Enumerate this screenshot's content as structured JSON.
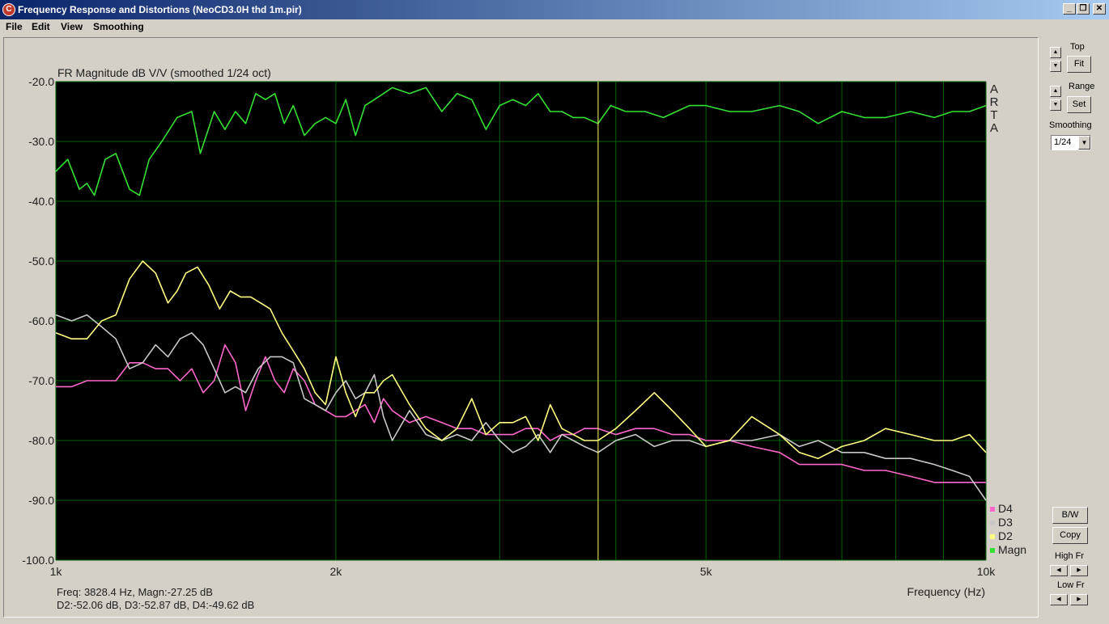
{
  "window": {
    "title": "Frequency Response and Distortions (NeoCD3.0H thd 1m.pir)",
    "min_label": "_",
    "restore_label": "❐",
    "close_label": "✕"
  },
  "menu": {
    "file": "File",
    "edit": "Edit",
    "view": "View",
    "smoothing": "Smoothing"
  },
  "readout": {
    "line1": "Freq: 3828.4 Hz, Magn:-27.25 dB",
    "line2": "D2:-52.06 dB, D3:-52.87 dB, D4:-49.62 dB"
  },
  "arta_letters": [
    "A",
    "R",
    "T",
    "A"
  ],
  "right_panel": {
    "top_label": "Top",
    "fit_label": "Fit",
    "range_label": "Range",
    "set_label": "Set",
    "smoothing_label": "Smoothing",
    "smoothing_value": "1/24",
    "bw_label": "B/W",
    "copy_label": "Copy",
    "high_fr_label": "High Fr",
    "low_fr_label": "Low Fr"
  },
  "colors": {
    "plot_bg": "#000000",
    "grid": "#006400",
    "magn": "#33e033",
    "d2": "#ffff80",
    "d3": "#c8c8c8",
    "d4": "#ff66cc",
    "cursor": "#ffff66"
  },
  "chart_data": {
    "type": "line",
    "title": "FR Magnitude dB V/V (smoothed 1/24 oct)",
    "xlabel": "Frequency (Hz)",
    "ylabel": "",
    "x_scale": "log",
    "xlim": [
      1000,
      10000
    ],
    "ylim": [
      -100,
      -20
    ],
    "y_ticks": [
      -20,
      -30,
      -40,
      -50,
      -60,
      -70,
      -80,
      -90,
      -100
    ],
    "y_tick_labels": [
      "-20.0",
      "-30.0",
      "-40.0",
      "-50.0",
      "-60.0",
      "-70.0",
      "-80.0",
      "-90.0",
      "-100.0"
    ],
    "x_ticks": [
      1000,
      2000,
      5000,
      10000
    ],
    "x_tick_labels": [
      "1k",
      "2k",
      "5k",
      "10k"
    ],
    "x_grid": [
      1000,
      2000,
      3000,
      4000,
      5000,
      6000,
      7000,
      8000,
      9000,
      10000
    ],
    "grid": true,
    "legend_position": "bottom-right",
    "cursor_x": 3828.4,
    "series": [
      {
        "name": "Magn",
        "color_key": "magn",
        "x": [
          1000,
          1030,
          1060,
          1080,
          1100,
          1130,
          1160,
          1200,
          1230,
          1260,
          1300,
          1350,
          1400,
          1430,
          1480,
          1520,
          1560,
          1600,
          1640,
          1680,
          1720,
          1760,
          1800,
          1850,
          1900,
          1950,
          2000,
          2050,
          2100,
          2150,
          2200,
          2250,
          2300,
          2400,
          2500,
          2600,
          2700,
          2800,
          2900,
          3000,
          3100,
          3200,
          3300,
          3400,
          3500,
          3600,
          3700,
          3828,
          3950,
          4100,
          4300,
          4500,
          4800,
          5000,
          5300,
          5600,
          6000,
          6300,
          6600,
          7000,
          7400,
          7800,
          8300,
          8800,
          9200,
          9600,
          10000
        ],
        "values": [
          -35,
          -33,
          -38,
          -37,
          -39,
          -33,
          -32,
          -38,
          -39,
          -33,
          -30,
          -26,
          -25,
          -32,
          -25,
          -28,
          -25,
          -27,
          -22,
          -23,
          -22,
          -27,
          -24,
          -29,
          -27,
          -26,
          -27,
          -23,
          -29,
          -24,
          -23,
          -22,
          -21,
          -22,
          -21,
          -25,
          -22,
          -23,
          -28,
          -24,
          -23,
          -24,
          -22,
          -25,
          -25,
          -26,
          -26,
          -27,
          -24,
          -25,
          -25,
          -26,
          -24,
          -24,
          -25,
          -25,
          -24,
          -25,
          -27,
          -25,
          -26,
          -26,
          -25,
          -26,
          -25,
          -25,
          -24
        ]
      },
      {
        "name": "D2",
        "color_key": "d2",
        "x": [
          1000,
          1040,
          1080,
          1120,
          1160,
          1200,
          1240,
          1280,
          1320,
          1350,
          1380,
          1420,
          1460,
          1500,
          1540,
          1580,
          1620,
          1660,
          1700,
          1750,
          1800,
          1850,
          1900,
          1950,
          2000,
          2050,
          2100,
          2150,
          2200,
          2250,
          2300,
          2400,
          2500,
          2600,
          2700,
          2800,
          2900,
          3000,
          3100,
          3200,
          3300,
          3400,
          3500,
          3600,
          3700,
          3828,
          4000,
          4200,
          4400,
          4600,
          4800,
          5000,
          5300,
          5600,
          6000,
          6300,
          6600,
          7000,
          7400,
          7800,
          8300,
          8800,
          9200,
          9600,
          10000
        ],
        "values": [
          -62,
          -63,
          -63,
          -60,
          -59,
          -53,
          -50,
          -52,
          -57,
          -55,
          -52,
          -51,
          -54,
          -58,
          -55,
          -56,
          -56,
          -57,
          -58,
          -62,
          -65,
          -68,
          -72,
          -74,
          -66,
          -72,
          -76,
          -72,
          -72,
          -70,
          -69,
          -74,
          -78,
          -80,
          -78,
          -73,
          -79,
          -77,
          -77,
          -76,
          -80,
          -74,
          -78,
          -79,
          -80,
          -80,
          -78,
          -75,
          -72,
          -75,
          -78,
          -81,
          -80,
          -76,
          -79,
          -82,
          -83,
          -81,
          -80,
          -78,
          -79,
          -80,
          -80,
          -79,
          -82
        ]
      },
      {
        "name": "D3",
        "color_key": "d3",
        "x": [
          1000,
          1040,
          1080,
          1120,
          1160,
          1200,
          1240,
          1280,
          1320,
          1360,
          1400,
          1440,
          1480,
          1520,
          1560,
          1600,
          1650,
          1700,
          1750,
          1800,
          1850,
          1900,
          1950,
          2000,
          2050,
          2100,
          2150,
          2200,
          2250,
          2300,
          2400,
          2500,
          2600,
          2700,
          2800,
          2900,
          3000,
          3100,
          3200,
          3300,
          3400,
          3500,
          3600,
          3700,
          3828,
          4000,
          4200,
          4400,
          4600,
          4800,
          5000,
          5300,
          5600,
          6000,
          6300,
          6600,
          7000,
          7400,
          7800,
          8300,
          8800,
          9200,
          9600,
          10000
        ],
        "values": [
          -59,
          -60,
          -59,
          -61,
          -63,
          -68,
          -67,
          -64,
          -66,
          -63,
          -62,
          -64,
          -68,
          -72,
          -71,
          -72,
          -68,
          -66,
          -66,
          -67,
          -73,
          -74,
          -75,
          -72,
          -70,
          -73,
          -72,
          -69,
          -76,
          -80,
          -75,
          -79,
          -80,
          -79,
          -80,
          -77,
          -80,
          -82,
          -81,
          -79,
          -82,
          -79,
          -80,
          -81,
          -82,
          -80,
          -79,
          -81,
          -80,
          -80,
          -81,
          -80,
          -80,
          -79,
          -81,
          -80,
          -82,
          -82,
          -83,
          -83,
          -84,
          -85,
          -86,
          -90
        ]
      },
      {
        "name": "D4",
        "color_key": "d4",
        "x": [
          1000,
          1040,
          1080,
          1120,
          1160,
          1200,
          1240,
          1280,
          1320,
          1360,
          1400,
          1440,
          1480,
          1520,
          1560,
          1600,
          1640,
          1680,
          1720,
          1760,
          1800,
          1850,
          1900,
          1950,
          2000,
          2050,
          2100,
          2150,
          2200,
          2250,
          2300,
          2400,
          2500,
          2600,
          2700,
          2800,
          2900,
          3000,
          3100,
          3200,
          3300,
          3400,
          3500,
          3600,
          3700,
          3828,
          4000,
          4200,
          4400,
          4600,
          4800,
          5000,
          5300,
          5600,
          6000,
          6300,
          6600,
          7000,
          7400,
          7800,
          8300,
          8800,
          9200,
          9600,
          10000
        ],
        "values": [
          -71,
          -71,
          -70,
          -70,
          -70,
          -67,
          -67,
          -68,
          -68,
          -70,
          -68,
          -72,
          -70,
          -64,
          -67,
          -75,
          -70,
          -66,
          -70,
          -72,
          -68,
          -70,
          -74,
          -75,
          -76,
          -76,
          -75,
          -74,
          -77,
          -73,
          -75,
          -77,
          -76,
          -77,
          -78,
          -78,
          -79,
          -79,
          -79,
          -78,
          -78,
          -80,
          -79,
          -79,
          -78,
          -78,
          -79,
          -78,
          -78,
          -79,
          -79,
          -80,
          -80,
          -81,
          -82,
          -84,
          -84,
          -84,
          -85,
          -85,
          -86,
          -87,
          -87,
          -87,
          -87
        ]
      }
    ]
  }
}
